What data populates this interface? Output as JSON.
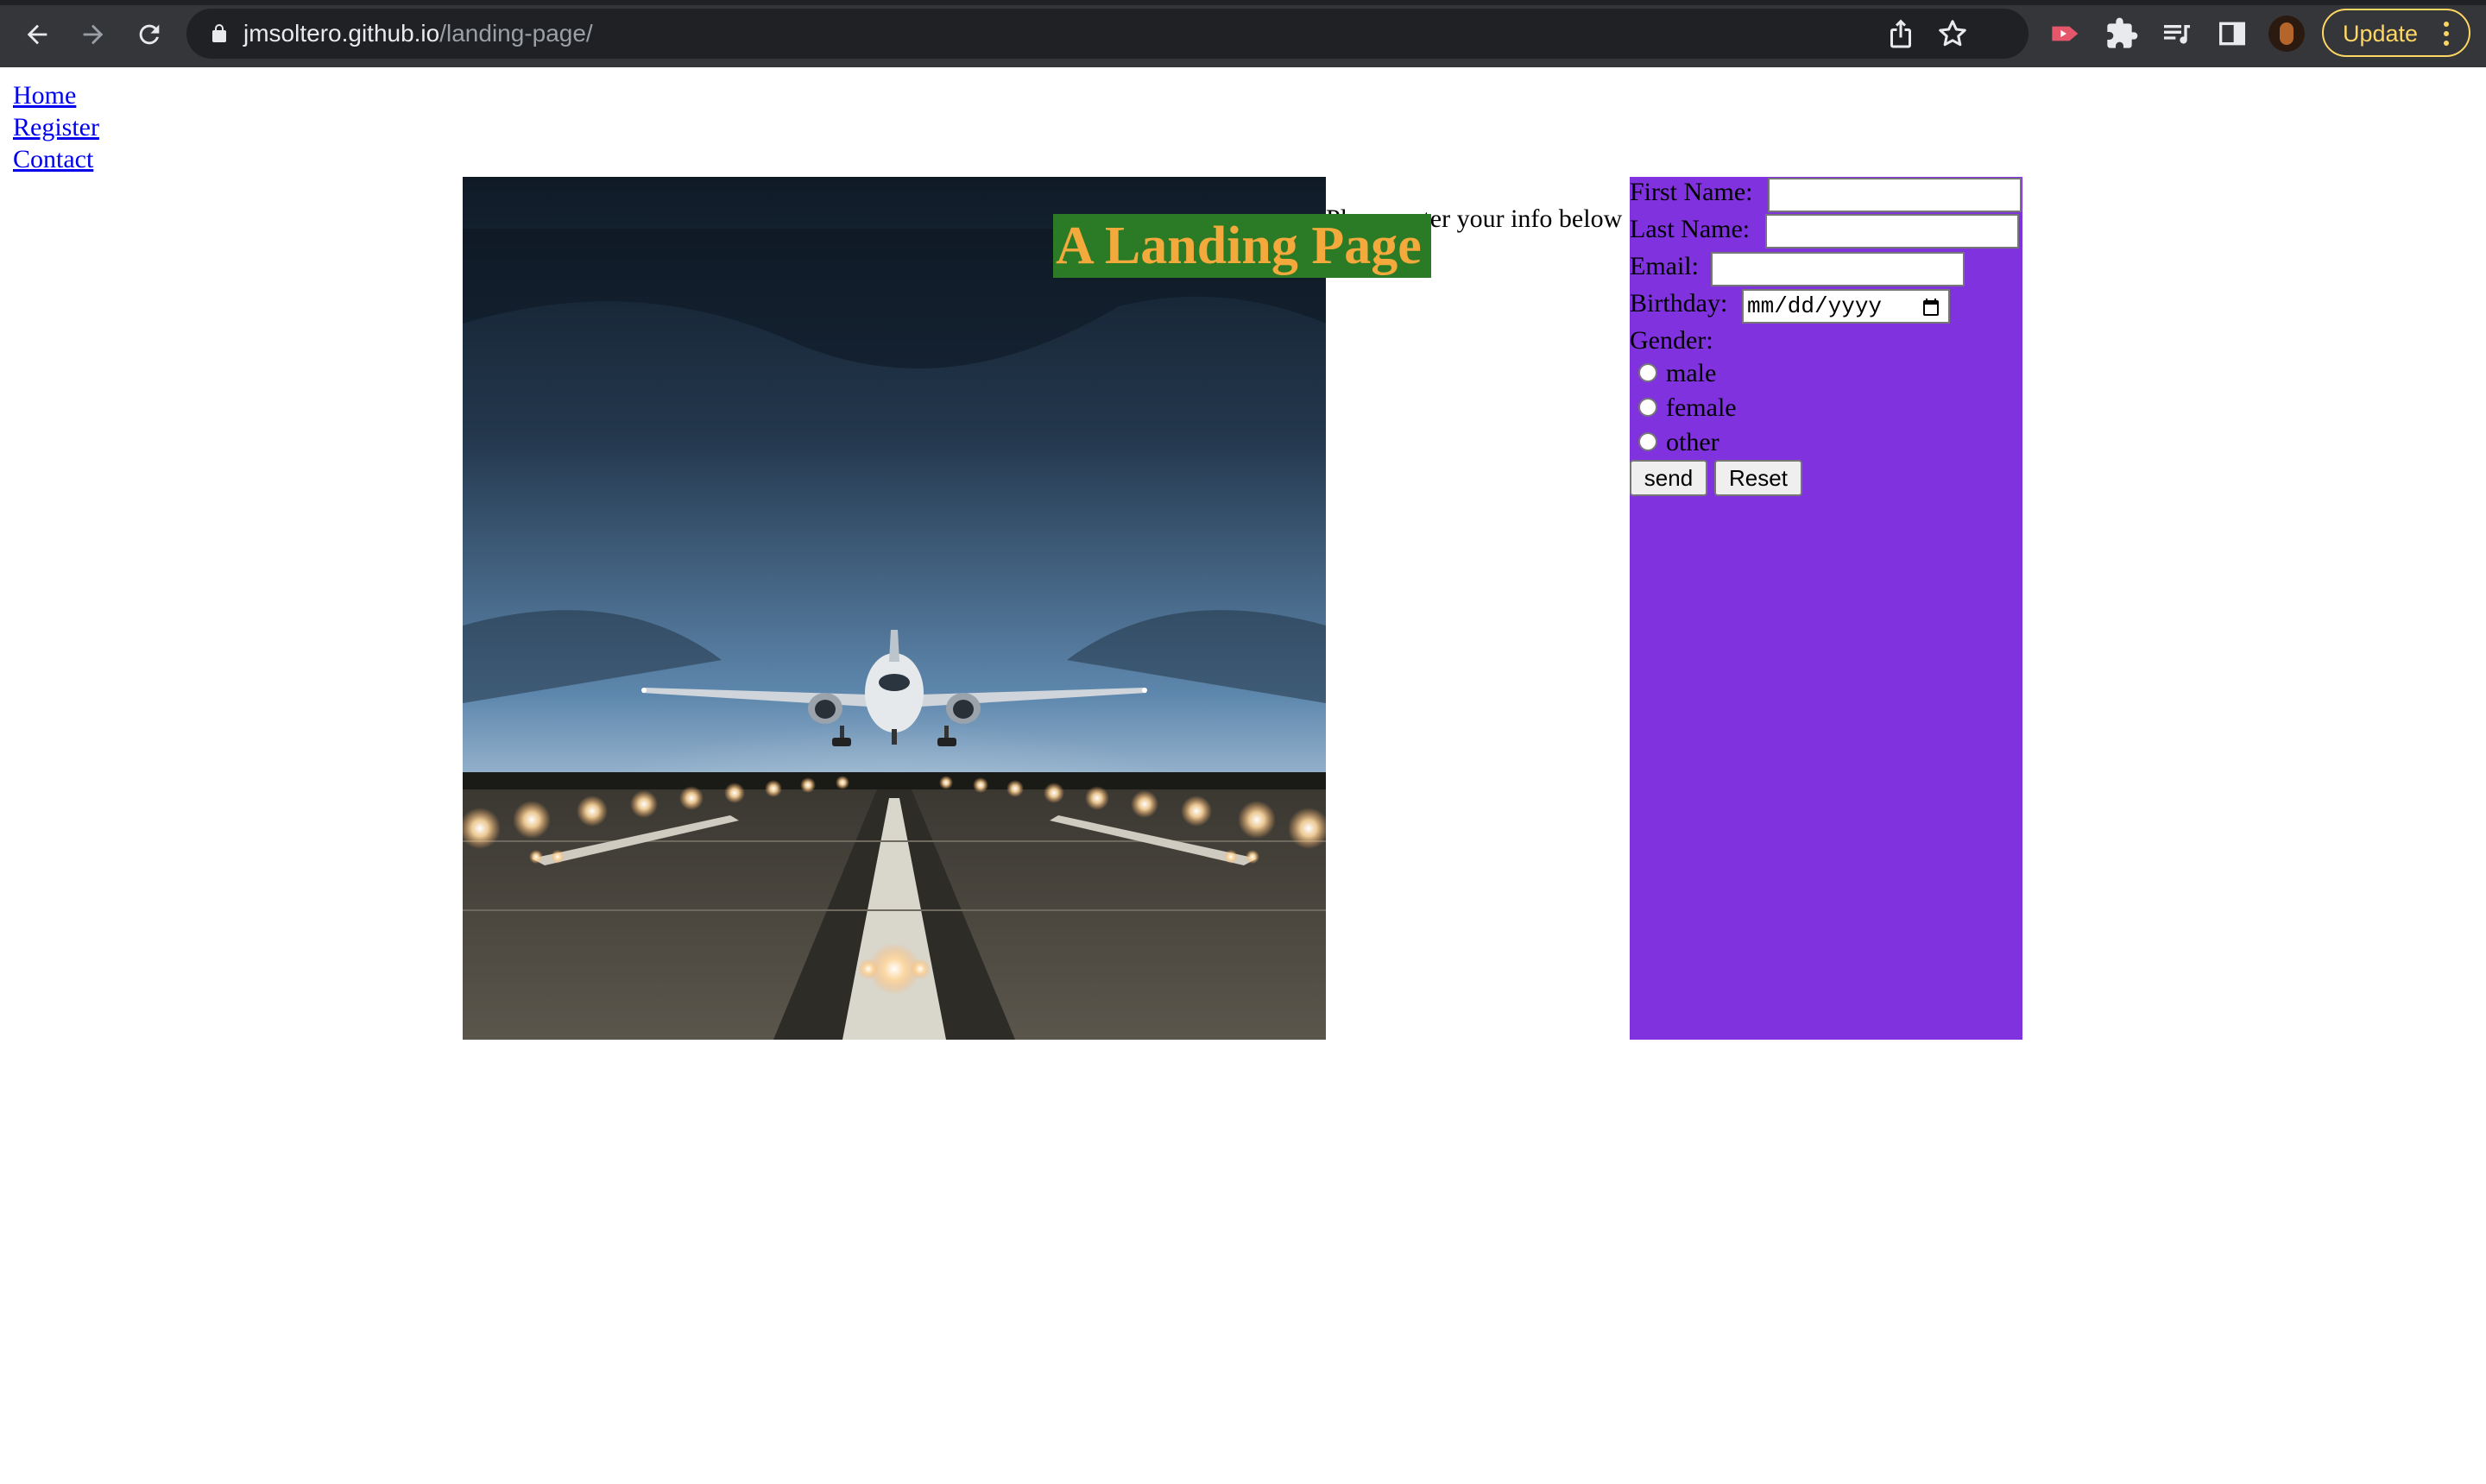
{
  "browser": {
    "url_host": "jmsoltero.github.io",
    "url_path": "/landing-page/",
    "update_label": "Update",
    "icons": [
      "back-arrow-icon",
      "forward-arrow-icon",
      "reload-icon",
      "lock-icon",
      "share-icon",
      "bookmark-star-icon",
      "extension-red-icon",
      "puzzle-extensions-icon",
      "reading-list-icon",
      "side-panel-icon",
      "profile-avatar",
      "more-vert-icon"
    ],
    "accent_color": "#fdd663"
  },
  "nav": {
    "home": "Home",
    "register": "Register",
    "contact": "Contact"
  },
  "intro_text": "Please enter your info below",
  "headline": "A Landing Page",
  "hero_image": {
    "subject": "airplane landing on runway"
  },
  "form": {
    "first_name_label": "First Name:",
    "last_name_label": "Last Name:",
    "email_label": "Email:",
    "birthday_label": "Birthday:",
    "birthday_placeholder": "mm/dd/yyyy",
    "gender_label": "Gender:",
    "gender_options": [
      "male",
      "female",
      "other"
    ],
    "send_label": "send",
    "reset_label": "Reset",
    "background_color": "#7f32dd"
  },
  "colors": {
    "headline_bg": "#2b7a25",
    "headline_text": "#f3a93c",
    "link": "#0000ee"
  }
}
